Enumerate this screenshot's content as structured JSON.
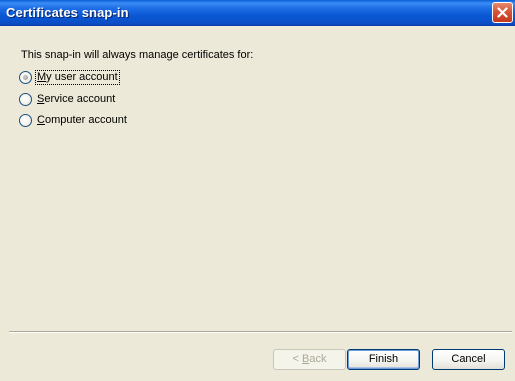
{
  "window": {
    "title": "Certificates snap-in",
    "close_icon": "close-icon"
  },
  "content": {
    "prompt": "This snap-in will always manage certificates for:",
    "options": [
      {
        "mnemonic": "M",
        "rest": "y user account",
        "selected": true
      },
      {
        "mnemonic": "S",
        "rest": "ervice account",
        "selected": false
      },
      {
        "mnemonic": "C",
        "rest": "omputer account",
        "selected": false
      }
    ]
  },
  "buttons": {
    "back": {
      "arrow": "<",
      "mnemonic": "B",
      "rest": "ack",
      "enabled": false
    },
    "finish": {
      "label": "Finish",
      "default": true
    },
    "cancel": {
      "label": "Cancel"
    }
  },
  "colors": {
    "titlebar": "#0a57d4",
    "dialog_bg": "#ece9d8",
    "close_button": "#d6553a"
  }
}
